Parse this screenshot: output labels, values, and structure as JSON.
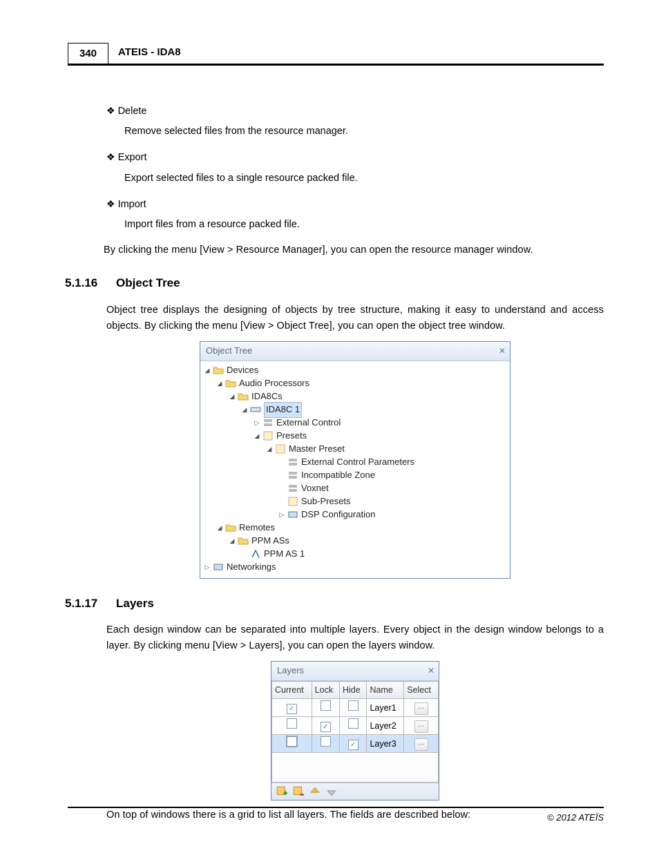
{
  "header": {
    "page_number": "340",
    "doc_title": "ATEIS - IDA8"
  },
  "sec_before": {
    "items": [
      {
        "title": "Delete",
        "desc": "Remove selected files from the resource manager."
      },
      {
        "title": "Export",
        "desc": "Export selected files to a single resource packed file."
      },
      {
        "title": "Import",
        "desc": "Import files from a resource packed file."
      }
    ],
    "tail": "By clicking the menu [View > Resource Manager], you can open the resource manager window."
  },
  "sec_ot": {
    "num": "5.1.16",
    "title": "Object Tree",
    "para": "Object tree displays the designing of objects by tree structure, making it easy to understand and access objects. By clicking the menu [View > Object Tree], you can open the object tree window.",
    "panel_title": "Object Tree",
    "tree": {
      "n0": "Devices",
      "n1": "Audio Processors",
      "n2": "IDA8Cs",
      "n3": "IDA8C 1",
      "n4": "External Control",
      "n5": "Presets",
      "n6": "Master Preset",
      "n7": "External Control Parameters",
      "n8": "Incompatible Zone",
      "n9": "Voxnet",
      "n10": "Sub-Presets",
      "n11": "DSP Configuration",
      "n12": "Remotes",
      "n13": "PPM ASs",
      "n14": "PPM AS 1",
      "n15": "Networkings"
    }
  },
  "sec_ly": {
    "num": "5.1.17",
    "title": "Layers",
    "para": "Each design window can be separated into multiple layers. Every object in the design window belongs to a layer. By clicking menu [View > Layers], you can open the layers window.",
    "panel_title": "Layers",
    "cols": {
      "c0": "Current",
      "c1": "Lock",
      "c2": "Hide",
      "c3": "Name",
      "c4": "Select"
    },
    "rows": {
      "r0": {
        "name": "Layer1",
        "current": true,
        "lock": false,
        "hide": false
      },
      "r1": {
        "name": "Layer2",
        "current": false,
        "lock": true,
        "hide": false
      },
      "r2": {
        "name": "Layer3",
        "current": false,
        "lock": false,
        "hide": true
      }
    },
    "tail": "On top of windows there is a grid to list all layers. The fields are described below:"
  },
  "footer": "© 2012 ATEÏS"
}
